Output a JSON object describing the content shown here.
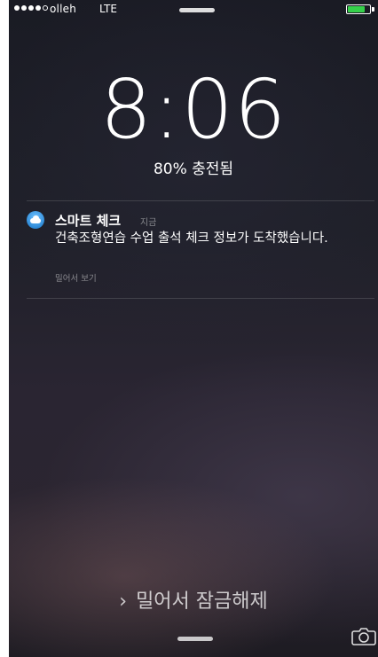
{
  "status_bar": {
    "signal_bars_filled": 4,
    "signal_bars_total": 5,
    "carrier": "olleh",
    "network": "LTE",
    "battery_fill_percent": 80,
    "battery_color": "#35d04a"
  },
  "clock": {
    "time": "8:06",
    "charging_status": "80% 충전됨"
  },
  "notification": {
    "app_icon": "cloud-app-icon",
    "app_name": "스마트 체크",
    "time_label": "지금",
    "message": "건축조형연습 수업 출석 체크 정보가 도착했습니다.",
    "action_hint": "밀어서 보기"
  },
  "bottom": {
    "unlock_chevron": "›",
    "unlock_text": "밀어서 잠금해제",
    "camera_icon": "camera-icon"
  }
}
